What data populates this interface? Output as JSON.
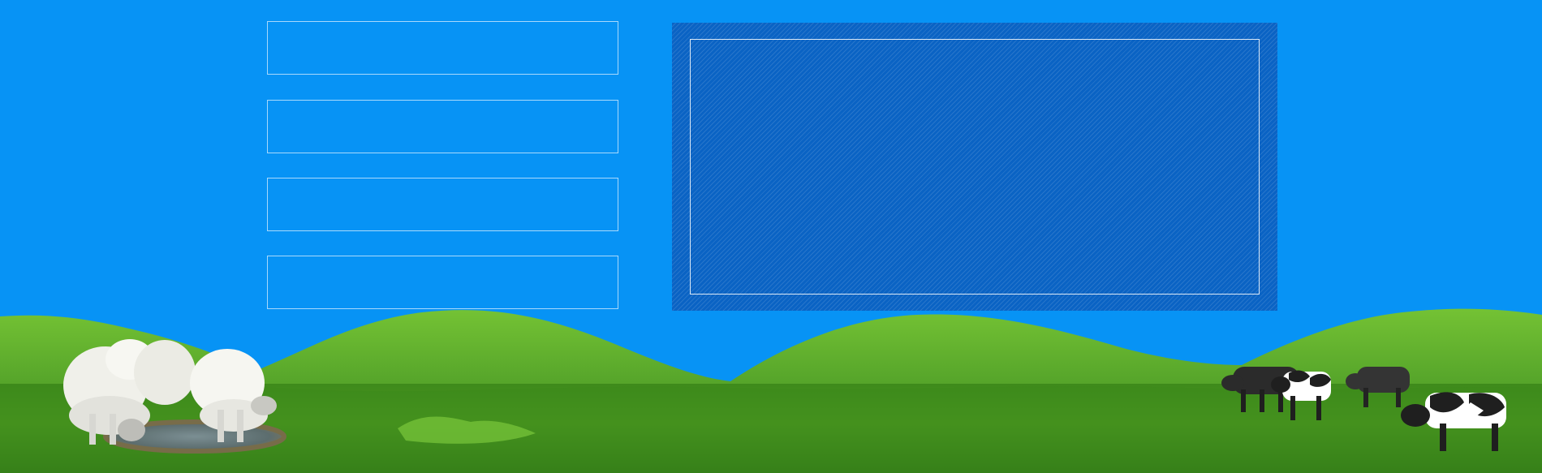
{
  "boxes": [
    {
      "id": "box-1",
      "label": ""
    },
    {
      "id": "box-2",
      "label": ""
    },
    {
      "id": "box-3",
      "label": ""
    },
    {
      "id": "box-4",
      "label": ""
    }
  ],
  "panel": {
    "content": ""
  },
  "colors": {
    "sky": "#0793f5",
    "panel": "#0a63c4",
    "grass_dark": "#2f7f18",
    "grass_light": "#74c234"
  },
  "scene": {
    "icons": [
      "sheep-icon",
      "cow-icon",
      "hill-icon",
      "puddle-icon"
    ]
  }
}
